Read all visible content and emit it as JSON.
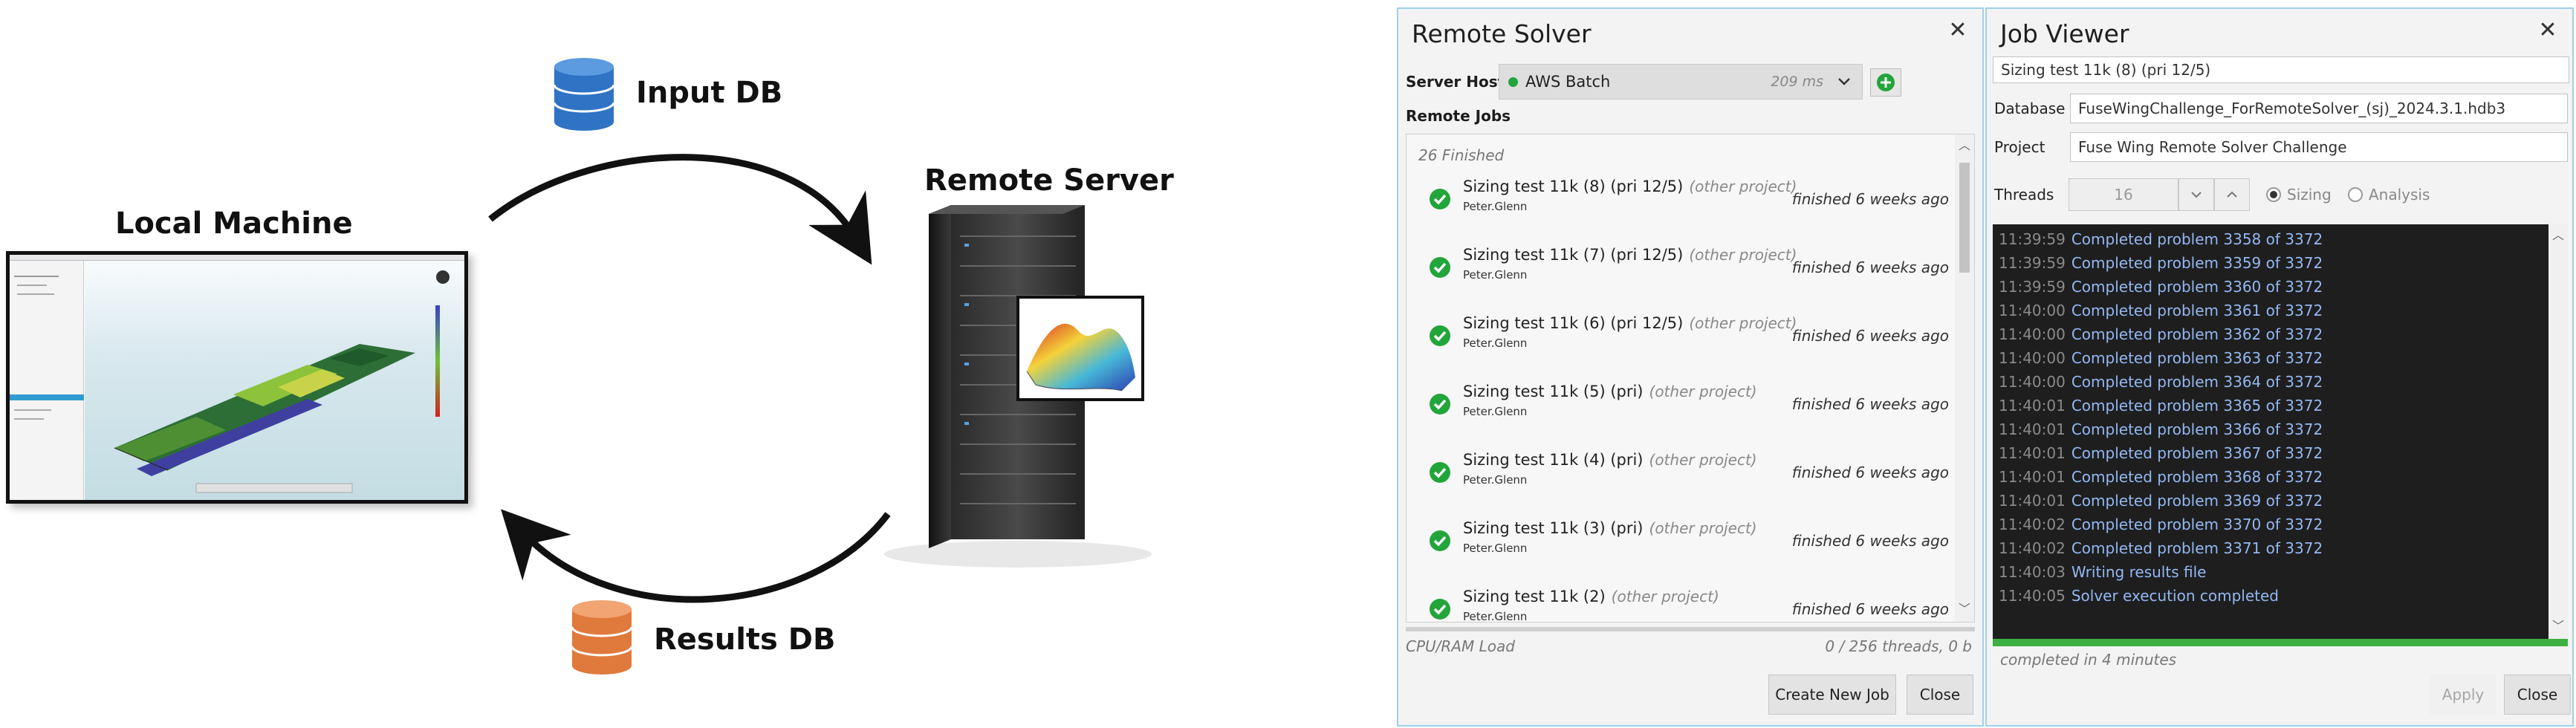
{
  "diagram": {
    "input_db_label": "Input DB",
    "results_db_label": "Results DB",
    "local_machine_label": "Local Machine",
    "remote_server_label": "Remote Server",
    "colors": {
      "input_db": "#2f73c4",
      "results_db": "#e07a3c",
      "arrow": "#111111"
    }
  },
  "remote_solver": {
    "title": "Remote Solver",
    "server_host_label": "Server Host",
    "server_host_value": "AWS Batch",
    "server_latency": "209 ms",
    "remote_jobs_label": "Remote Jobs",
    "jobs_summary": "26 Finished",
    "jobs": [
      {
        "name": "Sizing test 11k (8) (pri 12/5)",
        "tag": "(other project)",
        "user": "Peter.Glenn",
        "status": "finished 6 weeks ago"
      },
      {
        "name": "Sizing test 11k (7) (pri 12/5)",
        "tag": "(other project)",
        "user": "Peter.Glenn",
        "status": "finished 6 weeks ago"
      },
      {
        "name": "Sizing test 11k (6) (pri 12/5)",
        "tag": "(other project)",
        "user": "Peter.Glenn",
        "status": "finished 6 weeks ago"
      },
      {
        "name": "Sizing test 11k (5) (pri)",
        "tag": "(other project)",
        "user": "Peter.Glenn",
        "status": "finished 6 weeks ago"
      },
      {
        "name": "Sizing test 11k (4) (pri)",
        "tag": "(other project)",
        "user": "Peter.Glenn",
        "status": "finished 6 weeks ago"
      },
      {
        "name": "Sizing test 11k (3) (pri)",
        "tag": "(other project)",
        "user": "Peter.Glenn",
        "status": "finished 6 weeks ago"
      },
      {
        "name": "Sizing test 11k (2)",
        "tag": "(other project)",
        "user": "Peter.Glenn",
        "status": "finished 6 weeks ago"
      }
    ],
    "cpu_ram_label": "CPU/RAM Load",
    "cpu_ram_value": "0 / 256  threads, 0 b",
    "create_job_button": "Create New Job",
    "close_button": "Close",
    "colors": {
      "status_green": "#22a53a",
      "panel_border": "#9fd0ea"
    }
  },
  "job_viewer": {
    "title": "Job Viewer",
    "job_title": "Sizing test 11k (8) (pri 12/5)",
    "database_label": "Database",
    "database_value": "FuseWingChallenge_ForRemoteSolver_(sj)_2024.3.1.hdb3",
    "project_label": "Project",
    "project_value": "Fuse Wing Remote Solver Challenge",
    "threads_label": "Threads",
    "threads_value": "16",
    "mode_sizing": "Sizing",
    "mode_analysis": "Analysis",
    "selected_mode": "Sizing",
    "log": [
      {
        "time": "11:39:59",
        "msg": "Completed problem 3358 of 3372"
      },
      {
        "time": "11:39:59",
        "msg": "Completed problem 3359 of 3372"
      },
      {
        "time": "11:39:59",
        "msg": "Completed problem 3360 of 3372"
      },
      {
        "time": "11:40:00",
        "msg": "Completed problem 3361 of 3372"
      },
      {
        "time": "11:40:00",
        "msg": "Completed problem 3362 of 3372"
      },
      {
        "time": "11:40:00",
        "msg": "Completed problem 3363 of 3372"
      },
      {
        "time": "11:40:00",
        "msg": "Completed problem 3364 of 3372"
      },
      {
        "time": "11:40:01",
        "msg": "Completed problem 3365 of 3372"
      },
      {
        "time": "11:40:01",
        "msg": "Completed problem 3366 of 3372"
      },
      {
        "time": "11:40:01",
        "msg": "Completed problem 3367 of 3372"
      },
      {
        "time": "11:40:01",
        "msg": "Completed problem 3368 of 3372"
      },
      {
        "time": "11:40:01",
        "msg": "Completed problem 3369 of 3372"
      },
      {
        "time": "11:40:02",
        "msg": "Completed problem 3370 of 3372"
      },
      {
        "time": "11:40:02",
        "msg": "Completed problem 3371 of 3372"
      },
      {
        "time": "11:40:03",
        "msg": "Writing results file"
      },
      {
        "time": "11:40:05",
        "msg": "Solver execution completed"
      }
    ],
    "progress_fraction": 1.0,
    "completed_label": "completed in 4 minutes",
    "apply_button": "Apply",
    "close_button": "Close",
    "colors": {
      "console_bg": "#1e1e1e",
      "log_text": "#93b8f2",
      "progress": "#3cb043"
    }
  }
}
